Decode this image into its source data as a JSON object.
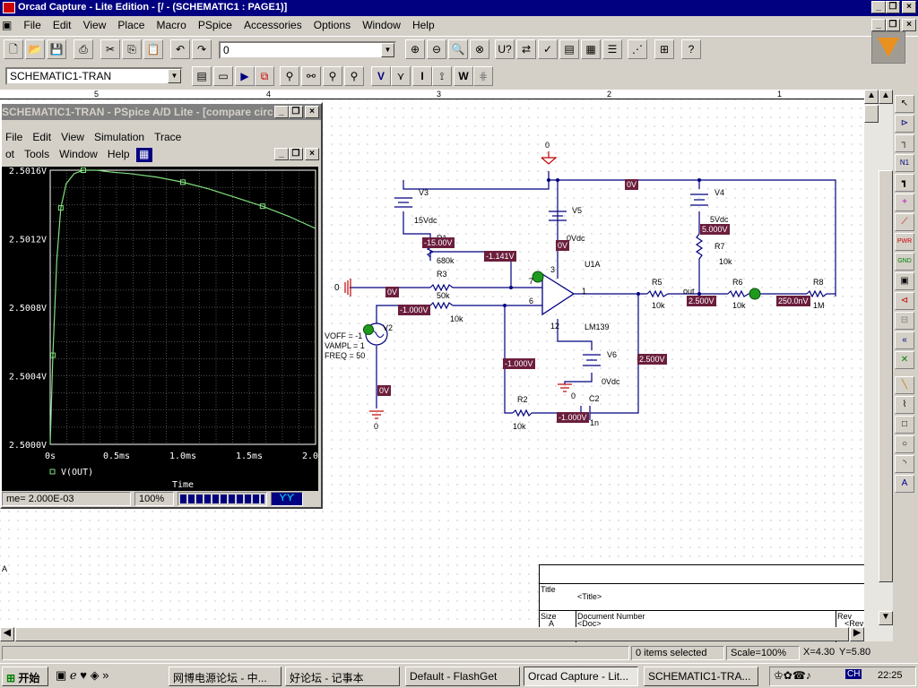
{
  "app": {
    "title": "Orcad Capture - Lite Edition - [/ - (SCHEMATIC1 : PAGE1)]"
  },
  "menu": [
    "File",
    "Edit",
    "View",
    "Place",
    "Macro",
    "PSpice",
    "Accessories",
    "Options",
    "Window",
    "Help"
  ],
  "toolbar": {
    "part_combo": "0",
    "profile_combo": "SCHEMATIC1-TRAN"
  },
  "ruler": {
    "marks": [
      "5",
      "4",
      "3",
      "2",
      "1"
    ]
  },
  "pspice": {
    "title": "SCHEMATIC1-TRAN - PSpice A/D Lite - [compare circ",
    "menu1": [
      "File",
      "Edit",
      "View",
      "Simulation",
      "Trace"
    ],
    "menu2": [
      "ot",
      "Tools",
      "Window",
      "Help"
    ],
    "status_time": "me= 2.000E-03",
    "status_pct": "100%",
    "legend": "V(OUT)",
    "xlabel": "Time"
  },
  "chart_data": {
    "type": "line",
    "title": "",
    "xlabel": "Time",
    "ylabel": "",
    "xlim": [
      0,
      2.0
    ],
    "ylim": [
      2.5,
      2.5016
    ],
    "xticks": [
      "0s",
      "0.5ms",
      "1.0ms",
      "1.5ms",
      "2.0ms"
    ],
    "yticks": [
      "2.5000V",
      "2.5004V",
      "2.5008V",
      "2.5012V",
      "2.5016V"
    ],
    "grid": true,
    "series": [
      {
        "name": "V(OUT)",
        "color": "#80e080",
        "x": [
          0,
          0.02,
          0.05,
          0.08,
          0.12,
          0.18,
          0.25,
          0.35,
          0.45,
          0.6,
          0.8,
          1.0,
          1.2,
          1.4,
          1.6,
          1.8,
          2.0
        ],
        "y": [
          2.5,
          2.50052,
          2.50108,
          2.50138,
          2.50152,
          2.50158,
          2.5016,
          2.5016,
          2.50159,
          2.50158,
          2.50156,
          2.50153,
          2.50149,
          2.50144,
          2.50139,
          2.50133,
          2.50126
        ]
      }
    ]
  },
  "schematic": {
    "components": [
      "V3",
      "15Vdc",
      "R1",
      "680k",
      "R3",
      "50k",
      "10k",
      "V2",
      "VOFF = -1",
      "VAMPL = 1",
      "FREQ = 50",
      "V5",
      "0Vdc",
      "U1A",
      "LM139",
      "V6",
      "0Vdc",
      "R2",
      "10k",
      "C2",
      "1n",
      "V4",
      "5Vdc",
      "R7",
      "10k",
      "R5",
      "10k",
      "out",
      "R6",
      "10k",
      "R8",
      "1M"
    ],
    "nodes": [
      "0",
      "0",
      "0",
      "0"
    ],
    "pins": [
      "7",
      "3",
      "6",
      "1",
      "12"
    ],
    "voltages": [
      "0V",
      "-15.00V",
      "-1.141V",
      "0V",
      "-1.000V",
      "0V",
      "0V",
      "5.000V",
      "-1.000V",
      "2.500V",
      "-1.000V",
      "2.500V",
      "250.0nV",
      "0V"
    ]
  },
  "titleblock": {
    "title_lbl": "Title",
    "title_val": "<Title>",
    "size_lbl": "Size",
    "size_val": "A",
    "docnum_lbl": "Document Number",
    "docnum_val": "<Doc>",
    "rev_lbl": "Rev",
    "rev_val": "<Rev Co"
  },
  "status": {
    "items": "0 items selected",
    "scale": "Scale=100%",
    "x": "X=4.30",
    "y": "Y=5.80"
  },
  "taskbar": {
    "start": "开始",
    "tasks": [
      "网博电源论坛 - 中...",
      "好论坛 - 记事本",
      "Default - FlashGet",
      "Orcad Capture - Lit...",
      "SCHEMATIC1-TRA..."
    ],
    "clock": "22:25",
    "ime": "CH"
  }
}
